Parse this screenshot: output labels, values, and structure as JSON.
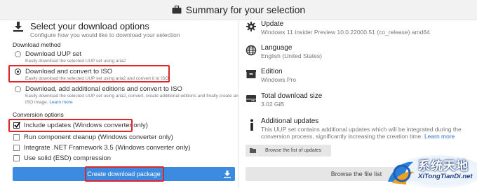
{
  "header": {
    "title": "Summary for your selection"
  },
  "options": {
    "title": "Select your download options",
    "subtitle": "Configure how you would like to download your selection",
    "download_method_heading": "Download method",
    "methods": [
      {
        "label": "Download UUP set",
        "desc": "Easily download the selected UUP set using aria2",
        "selected": false
      },
      {
        "label": "Download and convert to ISO",
        "desc": "Easily download the selected UUP set using aria2 and convert it to ISO.",
        "selected": true
      },
      {
        "label": "Download, add additional editions and convert to ISO",
        "desc": "Easily download the selected UUP set using aria2, convert, create additional editions and finally create an",
        "desc2": "ISO image.",
        "link": "Learn more",
        "selected": false
      }
    ],
    "conversion_heading": "Conversion options",
    "conversions": [
      {
        "label": "Include updates (Windows converter only)",
        "checked": true
      },
      {
        "label": "Run component cleanup (Windows converter only)",
        "checked": false
      },
      {
        "label": "Integrate .NET Framework 3.5 (Windows converter only)",
        "checked": false
      },
      {
        "label": "Use solid (ESD) compression",
        "checked": false
      }
    ],
    "create_button": "Create download package"
  },
  "summary": {
    "update_label": "Update",
    "update_value": "Windows 11 Insider Preview 10.0.22000.51 (co_release) amd64",
    "language_label": "Language",
    "language_value": "English (United States)",
    "edition_label": "Edition",
    "edition_value": "Windows Pro",
    "size_label": "Total download size",
    "size_value": "3.02 GiB",
    "additional_label": "Additional updates",
    "additional_line1": "This UUP set contains additional updates which will be integrated during the",
    "additional_line2": "conversion process, significantly increasing the creation time.",
    "additional_link": "Learn more",
    "browse_updates_button": "Browse the list of updates",
    "browse_files_button": "Browse the file list"
  },
  "watermark": {
    "text": "系统天地",
    "sub": "XiTongTianDi.net"
  },
  "colors": {
    "accent": "#3d8be0",
    "highlight": "#e0252a",
    "link": "#2f72c8"
  }
}
